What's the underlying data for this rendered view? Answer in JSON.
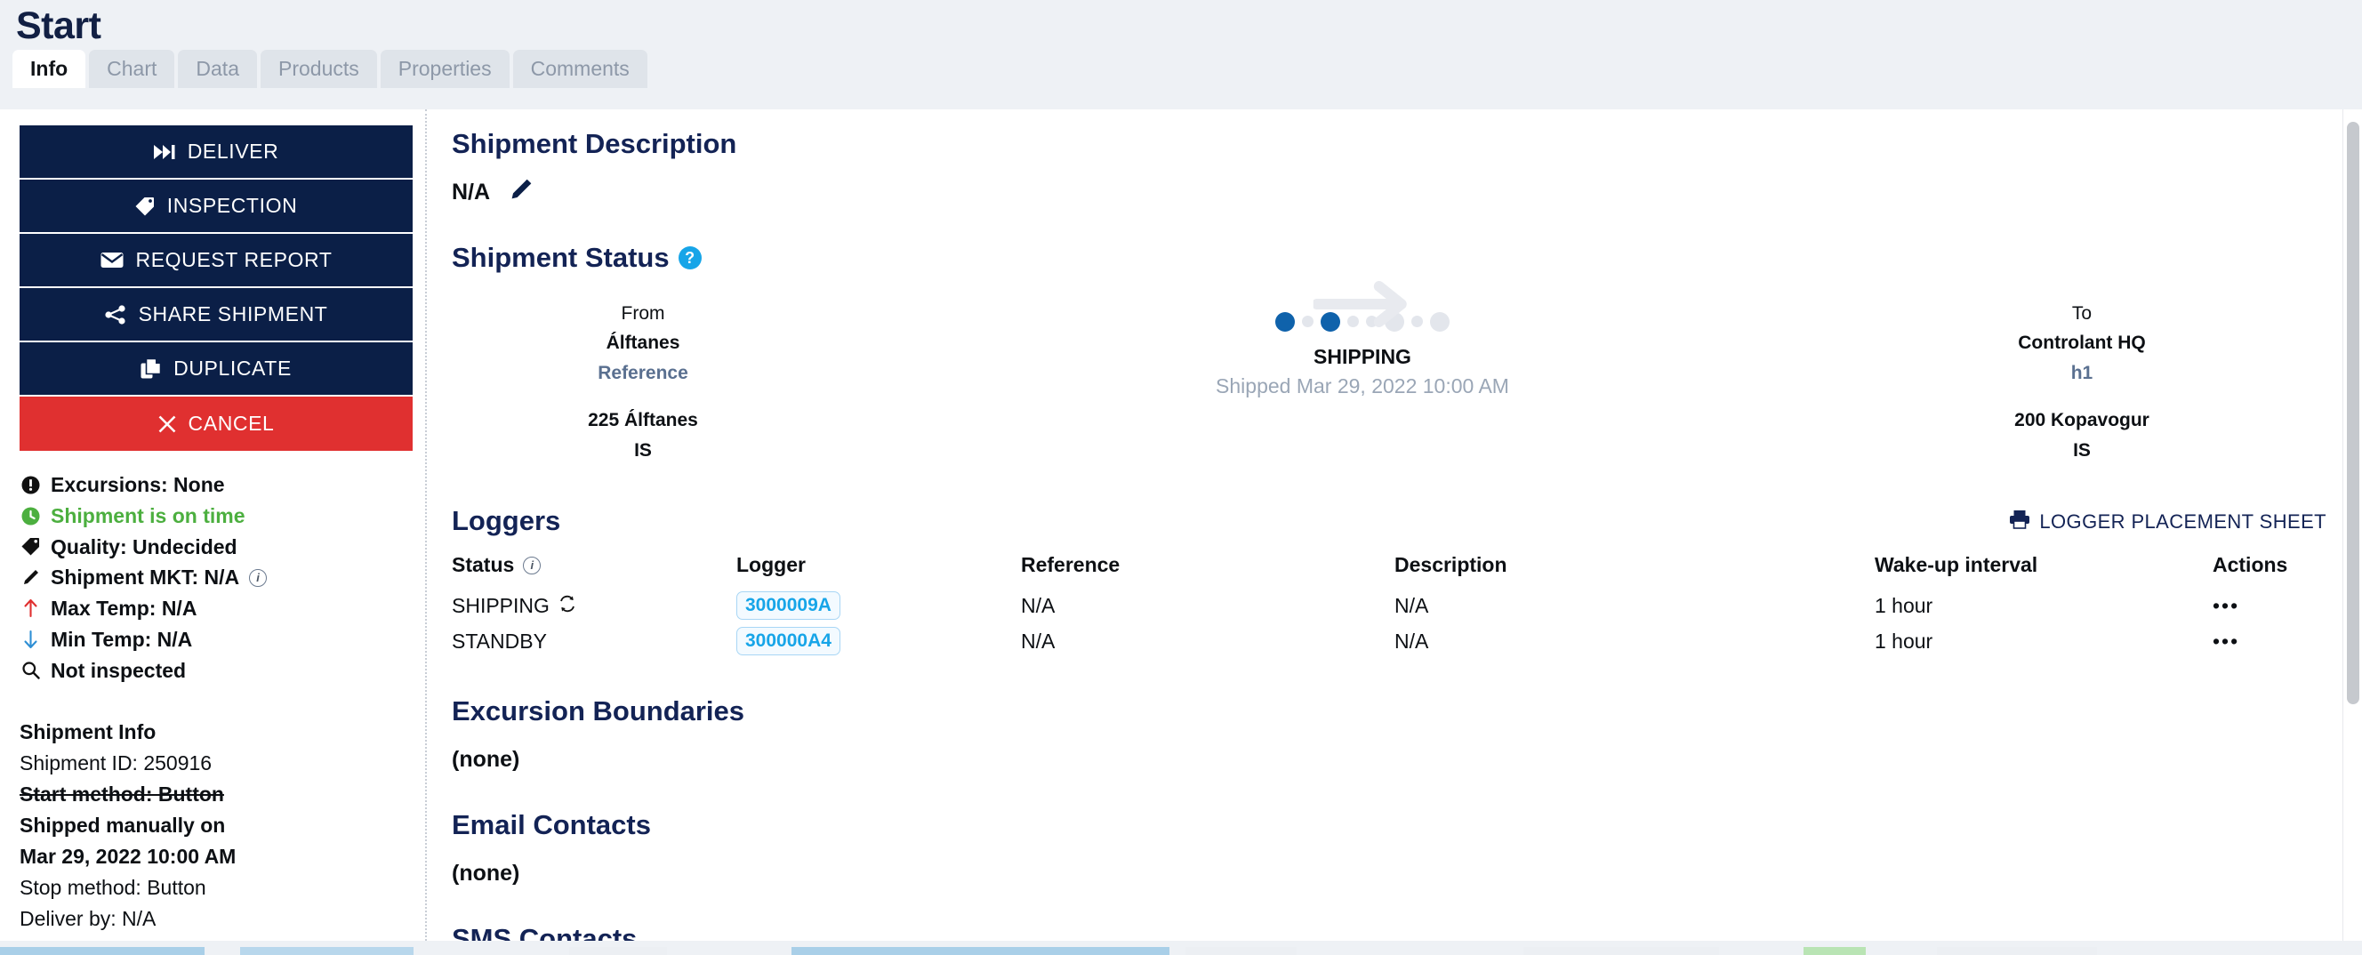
{
  "header": {
    "title": "Start",
    "tabs": [
      {
        "label": "Info",
        "active": true
      },
      {
        "label": "Chart",
        "active": false
      },
      {
        "label": "Data",
        "active": false
      },
      {
        "label": "Products",
        "active": false
      },
      {
        "label": "Properties",
        "active": false
      },
      {
        "label": "Comments",
        "active": false
      }
    ]
  },
  "sidebar": {
    "actions": [
      {
        "label": "DELIVER",
        "icon": "fast-forward-icon",
        "style": "primary"
      },
      {
        "label": "INSPECTION",
        "icon": "tag-icon",
        "style": "primary"
      },
      {
        "label": "REQUEST REPORT",
        "icon": "envelope-icon",
        "style": "primary"
      },
      {
        "label": "SHARE SHIPMENT",
        "icon": "share-icon",
        "style": "primary"
      },
      {
        "label": "DUPLICATE",
        "icon": "copy-icon",
        "style": "primary"
      },
      {
        "label": "CANCEL",
        "icon": "x-icon",
        "style": "danger"
      }
    ],
    "statuses": [
      {
        "label": "Excursions: None",
        "icon": "exclamation-icon",
        "color": "#0d1014",
        "info": false
      },
      {
        "label": "Shipment is on time",
        "icon": "clock-icon",
        "color": "#4caf3f",
        "info": false
      },
      {
        "label": "Quality: Undecided",
        "icon": "tag-icon",
        "color": "#0d1014",
        "info": false
      },
      {
        "label": "Shipment MKT: N/A",
        "icon": "thermometer-icon",
        "color": "#0d1014",
        "info": true
      },
      {
        "label": "Max Temp: N/A",
        "icon": "arrow-up-icon",
        "color": "#0d1014",
        "info": false
      },
      {
        "label": "Min Temp: N/A",
        "icon": "arrow-down-icon",
        "color": "#0d1014",
        "info": false
      },
      {
        "label": "Not inspected",
        "icon": "magnifier-icon",
        "color": "#0d1014",
        "info": false
      }
    ],
    "info": {
      "heading": "Shipment Info",
      "shipment_id": "Shipment ID: 250916",
      "start_method": "Start method: Button",
      "shipped_manually_line1": "Shipped manually on",
      "shipped_manually_line2": "Mar 29, 2022 10:00 AM",
      "stop_method": "Stop method: Button",
      "deliver_by": "Deliver by: N/A"
    }
  },
  "main": {
    "description": {
      "heading": "Shipment Description",
      "value": "N/A",
      "edit_icon": "pencil-icon"
    },
    "status": {
      "heading": "Shipment Status",
      "help_glyph": "?",
      "from": {
        "label": "From",
        "name": "Álftanes",
        "reference": "Reference",
        "address": "225 Álftanes",
        "country": "IS"
      },
      "to": {
        "label": "To",
        "name": "Controlant HQ",
        "reference": "h1",
        "address": "200 Kopavogur",
        "country": "IS"
      },
      "current_state": "SHIPPING",
      "substate": "Shipped Mar 29, 2022 10:00 AM",
      "progress_dots": [
        {
          "size": "lg",
          "active": true
        },
        {
          "size": "sm",
          "active": false
        },
        {
          "size": "lg",
          "active": true
        },
        {
          "size": "sm",
          "active": false
        },
        {
          "size": "sm",
          "active": false
        },
        {
          "size": "lg",
          "active": false
        },
        {
          "size": "sm",
          "active": false
        },
        {
          "size": "lg",
          "active": false
        }
      ],
      "active_color": "#0f62ab",
      "inactive_color": "#e3e6ec"
    },
    "loggers": {
      "heading": "Loggers",
      "placement_sheet_label": "LOGGER PLACEMENT SHEET",
      "placement_sheet_icon": "printer-icon",
      "columns": [
        "Status",
        "Logger",
        "Reference",
        "Description",
        "Wake-up interval",
        "Actions"
      ],
      "rows": [
        {
          "status": "SHIPPING",
          "status_icon": "sync-icon",
          "logger": "3000009A",
          "reference": "N/A",
          "description": "N/A",
          "wake_up_interval": "1 hour",
          "actions": "•••"
        },
        {
          "status": "STANDBY",
          "status_icon": "",
          "logger": "300000A4",
          "reference": "N/A",
          "description": "N/A",
          "wake_up_interval": "1 hour",
          "actions": "•••"
        }
      ]
    },
    "excursion_boundaries": {
      "heading": "Excursion Boundaries",
      "value": "(none)"
    },
    "email_contacts": {
      "heading": "Email Contacts",
      "value": "(none)"
    },
    "sms_contacts": {
      "heading": "SMS Contacts"
    }
  },
  "colors": {
    "brand_dark": "#0b1f47",
    "brand_heading": "#132355",
    "danger": "#e03030",
    "accent_blue": "#17a5e8",
    "progress_blue": "#0f62ab",
    "on_time_green": "#4caf3f"
  }
}
